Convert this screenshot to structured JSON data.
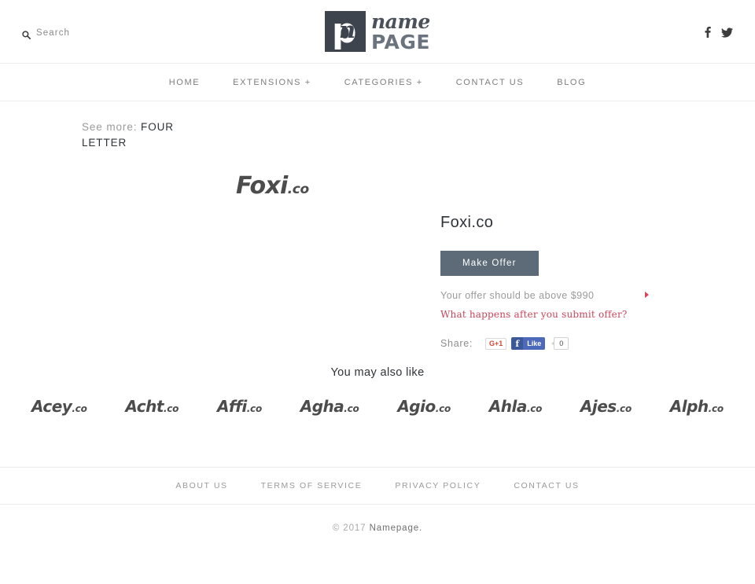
{
  "header": {
    "search": {
      "label": "Search",
      "icon": "search-icon"
    },
    "logo": {
      "mark_letter": "p",
      "script_letter": "n",
      "name": "name",
      "page": "PAGE"
    },
    "social": [
      {
        "name": "facebook",
        "icon": "facebook-icon",
        "glyph": "f"
      },
      {
        "name": "twitter",
        "icon": "twitter-icon"
      }
    ]
  },
  "nav": {
    "items": [
      {
        "label": "HOME"
      },
      {
        "label": "EXTENSIONS +"
      },
      {
        "label": "CATEGORIES +"
      },
      {
        "label": "CONTACT US"
      },
      {
        "label": "BLOG"
      }
    ]
  },
  "see_more": {
    "label": "See more:",
    "link": "FOUR LETTER"
  },
  "domain": {
    "hero_name": "Foxi",
    "hero_tld": ".co",
    "title": "Foxi.co",
    "offer_button": "Make Offer",
    "offer_note": "Your offer should be above $990",
    "offer_min_price": "$990",
    "offer_link": "What happens after you submit offer?",
    "share_label": "Share:",
    "gplus_label": "G+1",
    "fb_like_label": "Like",
    "fb_like_count": "0",
    "accent_red": "#c9455a",
    "button_color": "#5d6b78"
  },
  "also_like": {
    "title": "You may also like",
    "items": [
      {
        "name": "Acey",
        "tld": ".co"
      },
      {
        "name": "Acht",
        "tld": ".co"
      },
      {
        "name": "Affi",
        "tld": ".co"
      },
      {
        "name": "Agha",
        "tld": ".co"
      },
      {
        "name": "Agio",
        "tld": ".co"
      },
      {
        "name": "Ahla",
        "tld": ".co"
      },
      {
        "name": "Ajes",
        "tld": ".co"
      },
      {
        "name": "Alph",
        "tld": ".co"
      }
    ]
  },
  "footer": {
    "links": [
      {
        "label": "ABOUT US"
      },
      {
        "label": "TERMS OF SERVICE"
      },
      {
        "label": "PRIVACY POLICY"
      },
      {
        "label": "CONTACT US"
      }
    ],
    "copyright_year": "© 2017",
    "copyright_name": "Namepage."
  }
}
